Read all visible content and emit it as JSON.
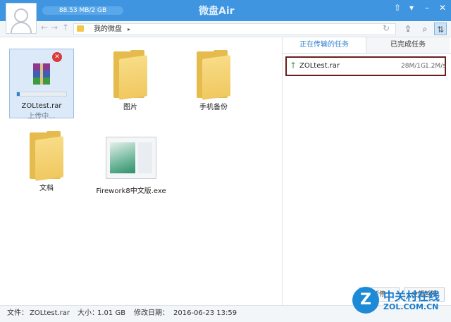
{
  "header": {
    "quota": "88.53 MB/2 GB",
    "app_title": "微盘Air",
    "window_controls": [
      "⇧",
      "▾",
      "–",
      "✕"
    ]
  },
  "toolbar": {
    "back_icon": "←",
    "forward_icon": "→",
    "up_icon": "↑",
    "breadcrumb": "我的微盘",
    "breadcrumb_arrow": "▸",
    "refresh_icon": "↻",
    "upload_icon": "⇪",
    "search_icon": "⌕",
    "transfer_icon": "⇅"
  },
  "files": [
    {
      "name": "ZOLtest.rar",
      "status": "上传中...",
      "progress": 0.05,
      "cancel": "✕",
      "type": "rar"
    },
    {
      "name": "图片",
      "type": "folder"
    },
    {
      "name": "手机备份",
      "type": "folder"
    },
    {
      "name": "文档",
      "type": "folder"
    },
    {
      "name": "Firework8中文版.exe",
      "type": "exe"
    }
  ],
  "transfer_panel": {
    "tab_active": "正在传输的任务",
    "tab_inactive": "已完成任务",
    "task": {
      "arrow": "↑",
      "name": "ZOLtest.rar",
      "size": "28M/1G",
      "speed": "1.2M/s"
    },
    "btn_left": "暂停",
    "btn_right": "全部暂停"
  },
  "status": {
    "file_label": "文件：",
    "file_value": "ZOLtest.rar",
    "size_label": "大小：",
    "size_value": "1.01 GB",
    "modified_label": "修改日期：",
    "modified_value": "2016-06-23 13:59"
  },
  "watermark": {
    "logo_letter": "Z",
    "cn": "中关村在线",
    "url": "ZOL.COM.CN"
  },
  "colors": {
    "titlebar": "#3f95e0",
    "accent": "#2f7fd0",
    "folder": "#f0c860",
    "highlight_border": "#6b1d1d"
  }
}
